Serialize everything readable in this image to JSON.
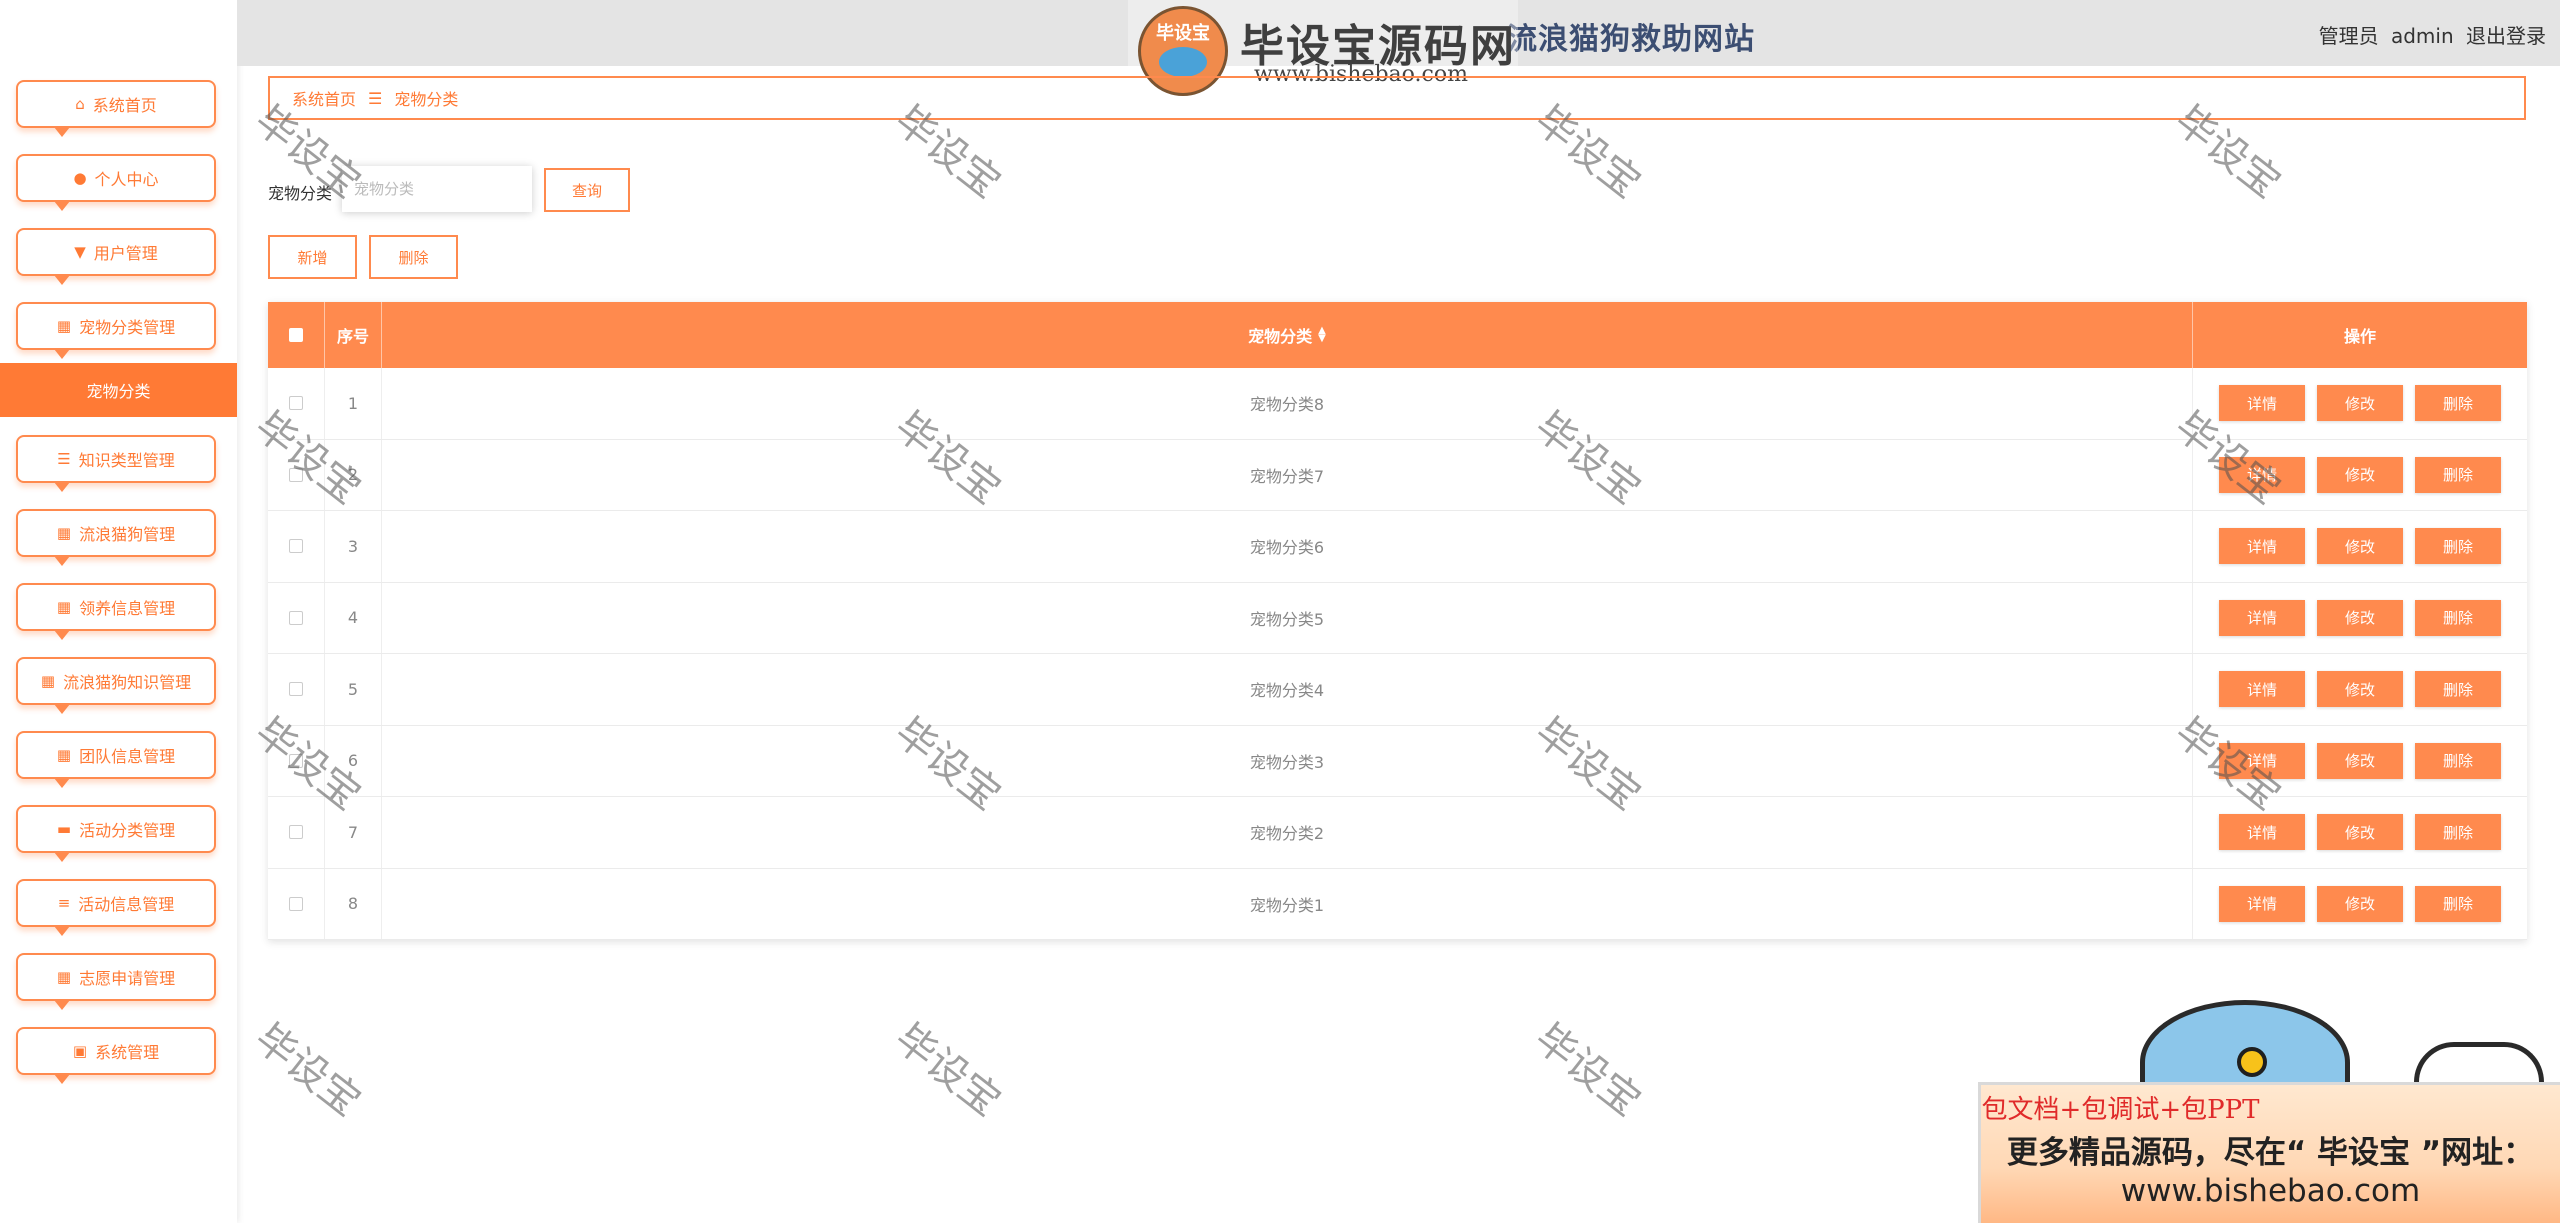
{
  "header": {
    "site_title": "流浪猫狗救助网站",
    "role": "管理员",
    "username": "admin",
    "logout": "退出登录"
  },
  "logo_watermark": {
    "badge": "毕设宝",
    "main": "毕设宝源码网",
    "url": "www.bishebao.com"
  },
  "sidebar": {
    "items": [
      {
        "label": "系统首页",
        "icon": "home-icon"
      },
      {
        "label": "个人中心",
        "icon": "user-icon"
      },
      {
        "label": "用户管理",
        "icon": "flag-icon"
      },
      {
        "label": "宠物分类管理",
        "icon": "grid-icon"
      },
      {
        "label": "知识类型管理",
        "icon": "sliders-icon"
      },
      {
        "label": "流浪猫狗管理",
        "icon": "grid-icon"
      },
      {
        "label": "领养信息管理",
        "icon": "grid-icon"
      },
      {
        "label": "流浪猫狗知识管理",
        "icon": "grid-icon"
      },
      {
        "label": "团队信息管理",
        "icon": "grid-icon"
      },
      {
        "label": "活动分类管理",
        "icon": "chat-icon"
      },
      {
        "label": "活动信息管理",
        "icon": "list-icon"
      },
      {
        "label": "志愿申请管理",
        "icon": "grid-icon"
      },
      {
        "label": "系统管理",
        "icon": "clipboard-icon"
      }
    ],
    "active_sub": "宠物分类"
  },
  "breadcrumb": {
    "home": "系统首页",
    "separator": "☰",
    "current": "宠物分类"
  },
  "search": {
    "label": "宠物分类",
    "placeholder": "宠物分类",
    "button": "查询"
  },
  "actions": {
    "add": "新增",
    "delete": "删除"
  },
  "table": {
    "headers": {
      "index": "序号",
      "name": "宠物分类",
      "ops": "操作"
    },
    "rows": [
      {
        "index": "1",
        "name": "宠物分类8"
      },
      {
        "index": "2",
        "name": "宠物分类7"
      },
      {
        "index": "3",
        "name": "宠物分类6"
      },
      {
        "index": "4",
        "name": "宠物分类5"
      },
      {
        "index": "5",
        "name": "宠物分类4"
      },
      {
        "index": "6",
        "name": "宠物分类3"
      },
      {
        "index": "7",
        "name": "宠物分类2"
      },
      {
        "index": "8",
        "name": "宠物分类1"
      }
    ],
    "row_buttons": {
      "detail": "详情",
      "edit": "修改",
      "delete": "删除"
    }
  },
  "watermark_text": "毕设宝",
  "promo": {
    "line1": "包文档+包调试+包PPT",
    "line2": "更多精品源码，尽在“ 毕设宝 ”网址：",
    "line3": "www.bishebao.com"
  },
  "colors": {
    "accent": "#ff8a4e",
    "accent_text": "#ff7a35",
    "header_bg": "#e4e4e4"
  }
}
